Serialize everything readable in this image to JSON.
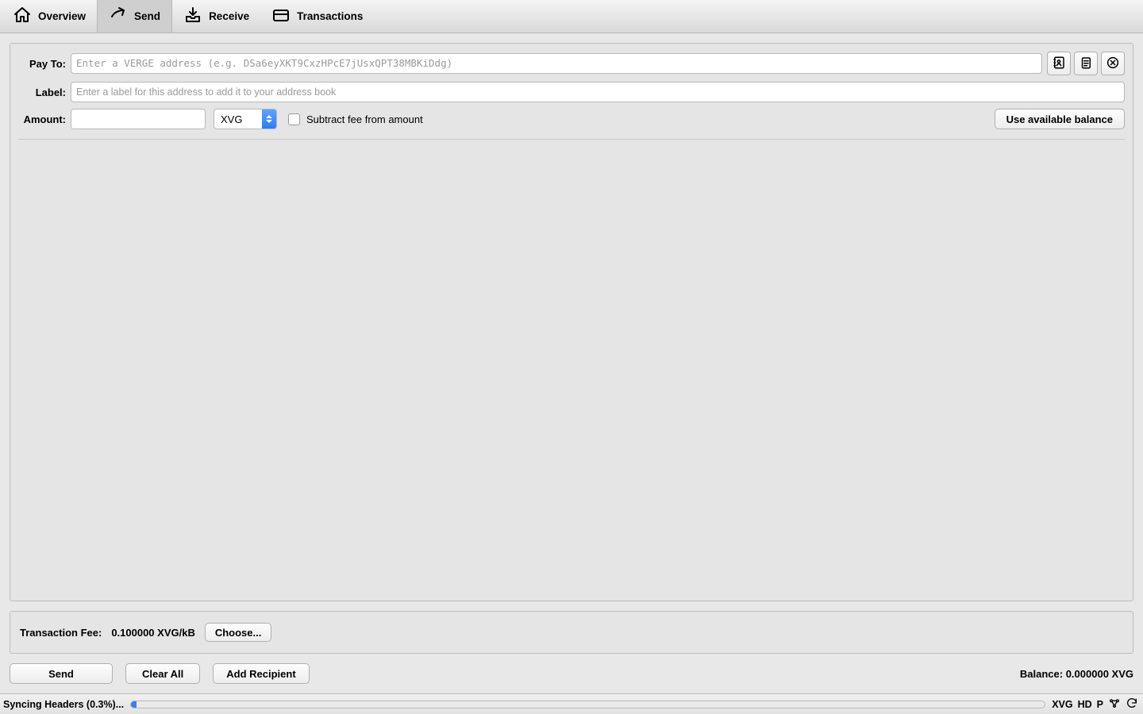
{
  "tabs": {
    "overview": "Overview",
    "send": "Send",
    "receive": "Receive",
    "transactions": "Transactions"
  },
  "form": {
    "payto_label": "Pay To:",
    "payto_placeholder": "Enter a VERGE address (e.g. DSa6eyXKT9CxzHPcE7jUsxQPT38MBKiDdg)",
    "label_label": "Label:",
    "label_placeholder": "Enter a label for this address to add it to your address book",
    "amount_label": "Amount:",
    "unit": "XVG",
    "subtract_fee": "Subtract fee from amount",
    "use_available": "Use available balance"
  },
  "fee": {
    "label": "Transaction Fee:",
    "value": "0.100000 XVG/kB",
    "choose": "Choose..."
  },
  "actions": {
    "send": "Send",
    "clear_all": "Clear All",
    "add_recipient": "Add Recipient"
  },
  "balance": {
    "label": "Balance:",
    "value": "0.000000 XVG"
  },
  "status": {
    "text": "Syncing Headers (0.3%)...",
    "ticker": "XVG",
    "hd": "HD",
    "proxy": "P"
  }
}
